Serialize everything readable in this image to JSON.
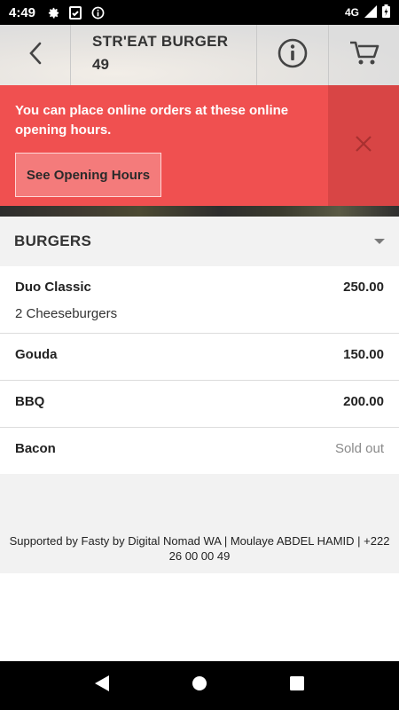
{
  "status_bar": {
    "time": "4:49",
    "network": "4G",
    "icons": [
      "settings-gear-icon",
      "clipboard-check-icon",
      "info-circle-icon",
      "signal-icon",
      "battery-icon"
    ]
  },
  "header": {
    "title_line1": "STR'EAT BURGER",
    "title_line2": "49",
    "icons": [
      "back-chevron-icon",
      "info-icon",
      "cart-icon"
    ]
  },
  "banner": {
    "message": "You can place online orders at these online opening hours.",
    "button_label": "See Opening Hours",
    "color": "#f05050"
  },
  "category": {
    "name": "BURGERS"
  },
  "items": [
    {
      "name": "Duo Classic",
      "price": "250.00",
      "description": "2 Cheeseburgers"
    },
    {
      "name": "Gouda",
      "price": "150.00"
    },
    {
      "name": "BBQ",
      "price": "200.00"
    },
    {
      "name": "Bacon",
      "price": "Sold out"
    }
  ],
  "footer": {
    "text": "Supported by Fasty by Digital Nomad WA | Moulaye ABDEL HAMID | +222 26 00 00 49"
  },
  "nav": {
    "icons": [
      "nav-back-icon",
      "nav-home-icon",
      "nav-recents-icon"
    ]
  }
}
